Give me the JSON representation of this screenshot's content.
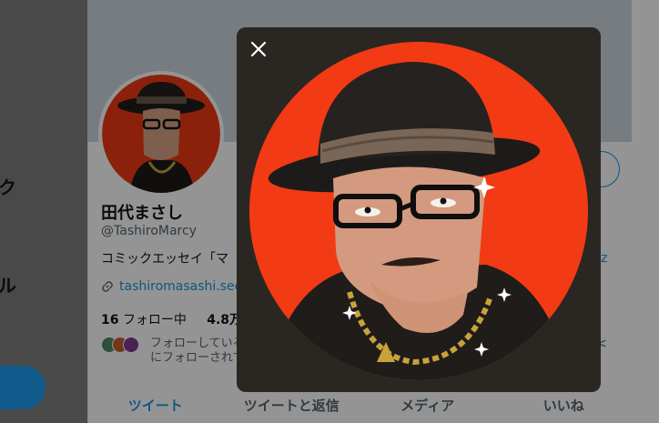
{
  "left_nav": {
    "item_1_fragment": "ク",
    "item_2_fragment": "ル"
  },
  "profile": {
    "display_name": "田代まさし",
    "handle": "@TashiroMarcy",
    "bio": "コミックエッセイ「マ",
    "link": "tashiromasashi.see",
    "following_count": "16",
    "following_label": "フォロー中",
    "followers_count": "4.8万",
    "known_followers_line1": "フォローしている",
    "known_followers_line2": "にフォローされて",
    "right_edge_text": "-z",
    "right_edge_chevron": "<"
  },
  "tabs": [
    {
      "label": "ツイート"
    },
    {
      "label": "ツイートと返信"
    },
    {
      "label": "メディア"
    },
    {
      "label": "いいね"
    }
  ],
  "modal": {
    "close_icon": "close-icon"
  },
  "colors": {
    "accent": "#1b95e0",
    "avatar_bg": "#f23a14",
    "modal_bg": "#2a2722"
  }
}
